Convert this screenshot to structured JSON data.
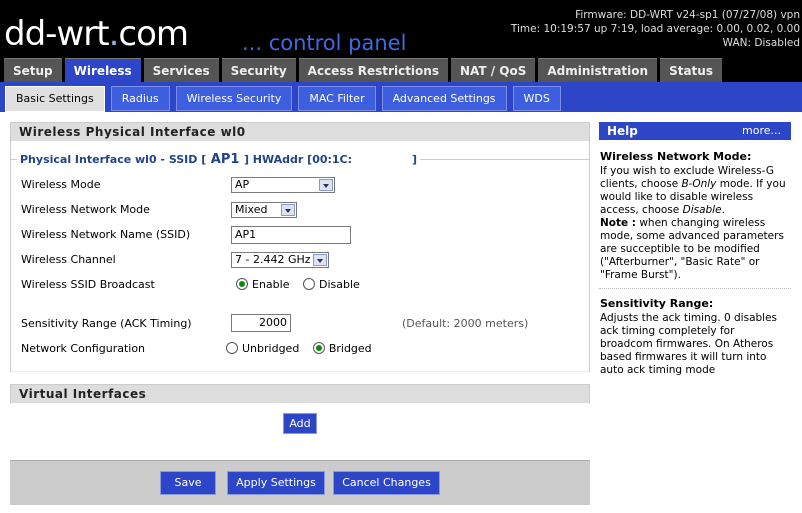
{
  "header": {
    "logo_main": "dd-wrt",
    "logo_dot": ".",
    "logo_suffix": "com",
    "control_panel": "... control panel",
    "firmware": "Firmware: DD-WRT v24-sp1 (07/27/08) vpn",
    "time": "Time: 10:19:57 up 7:19, load average: 0.00, 0.02, 0.00",
    "wan": "WAN: Disabled"
  },
  "main_tabs": [
    {
      "label": "Setup"
    },
    {
      "label": "Wireless"
    },
    {
      "label": "Services"
    },
    {
      "label": "Security"
    },
    {
      "label": "Access Restrictions"
    },
    {
      "label": "NAT / QoS"
    },
    {
      "label": "Administration"
    },
    {
      "label": "Status"
    }
  ],
  "sub_tabs": [
    {
      "label": "Basic Settings"
    },
    {
      "label": "Radius"
    },
    {
      "label": "Wireless Security"
    },
    {
      "label": "MAC Filter"
    },
    {
      "label": "Advanced Settings"
    },
    {
      "label": "WDS"
    }
  ],
  "physical": {
    "title": "Wireless Physical Interface wl0",
    "legend_prefix": "Physical Interface wl0 - SSID [",
    "legend_ssid": " AP1 ",
    "legend_suffix": "] HWAddr [00:1C:",
    "legend_end": "]",
    "wireless_mode": {
      "label": "Wireless Mode",
      "value": "AP"
    },
    "network_mode": {
      "label": "Wireless Network Mode",
      "value": "Mixed"
    },
    "ssid": {
      "label": "Wireless Network Name (SSID)",
      "value": "AP1"
    },
    "channel": {
      "label": "Wireless Channel",
      "value": "7 - 2.442 GHz"
    },
    "broadcast": {
      "label": "Wireless SSID Broadcast",
      "opt1": "Enable",
      "opt2": "Disable",
      "selected": "Enable"
    },
    "sensitivity": {
      "label": "Sensitivity Range (ACK Timing)",
      "value": "2000",
      "hint": "(Default: 2000 meters)"
    },
    "netconfig": {
      "label": "Network Configuration",
      "opt1": "Unbridged",
      "opt2": "Bridged",
      "selected": "Bridged"
    }
  },
  "virtual": {
    "title": "Virtual Interfaces",
    "add_label": "Add"
  },
  "footer": {
    "save": "Save",
    "apply": "Apply Settings",
    "cancel": "Cancel Changes"
  },
  "help": {
    "title": "Help",
    "more": "more...",
    "mode_title": "Wireless Network Mode:",
    "mode_text1": "If you wish to exclude Wireless-G clients, choose ",
    "mode_bonly": "B-Only",
    "mode_text2": " mode. If you would like to disable wireless access, choose ",
    "mode_disable": "Disable",
    "mode_text3": ".",
    "note_label": "Note :",
    "note_text": " when changing wireless mode, some advanced parameters are succeptible to be modified (\"Afterburner\", \"Basic Rate\" or \"Frame Burst\").",
    "sens_title": "Sensitivity Range:",
    "sens_text": "Adjusts the ack timing. 0 disables ack timing completely for broadcom firmwares. On Atheros based firmwares it will turn into auto ack timing mode"
  },
  "colors": {
    "accent": "#2d46c8",
    "tab_inactive": "#555555",
    "radio_selected": "#0a8a0a"
  }
}
